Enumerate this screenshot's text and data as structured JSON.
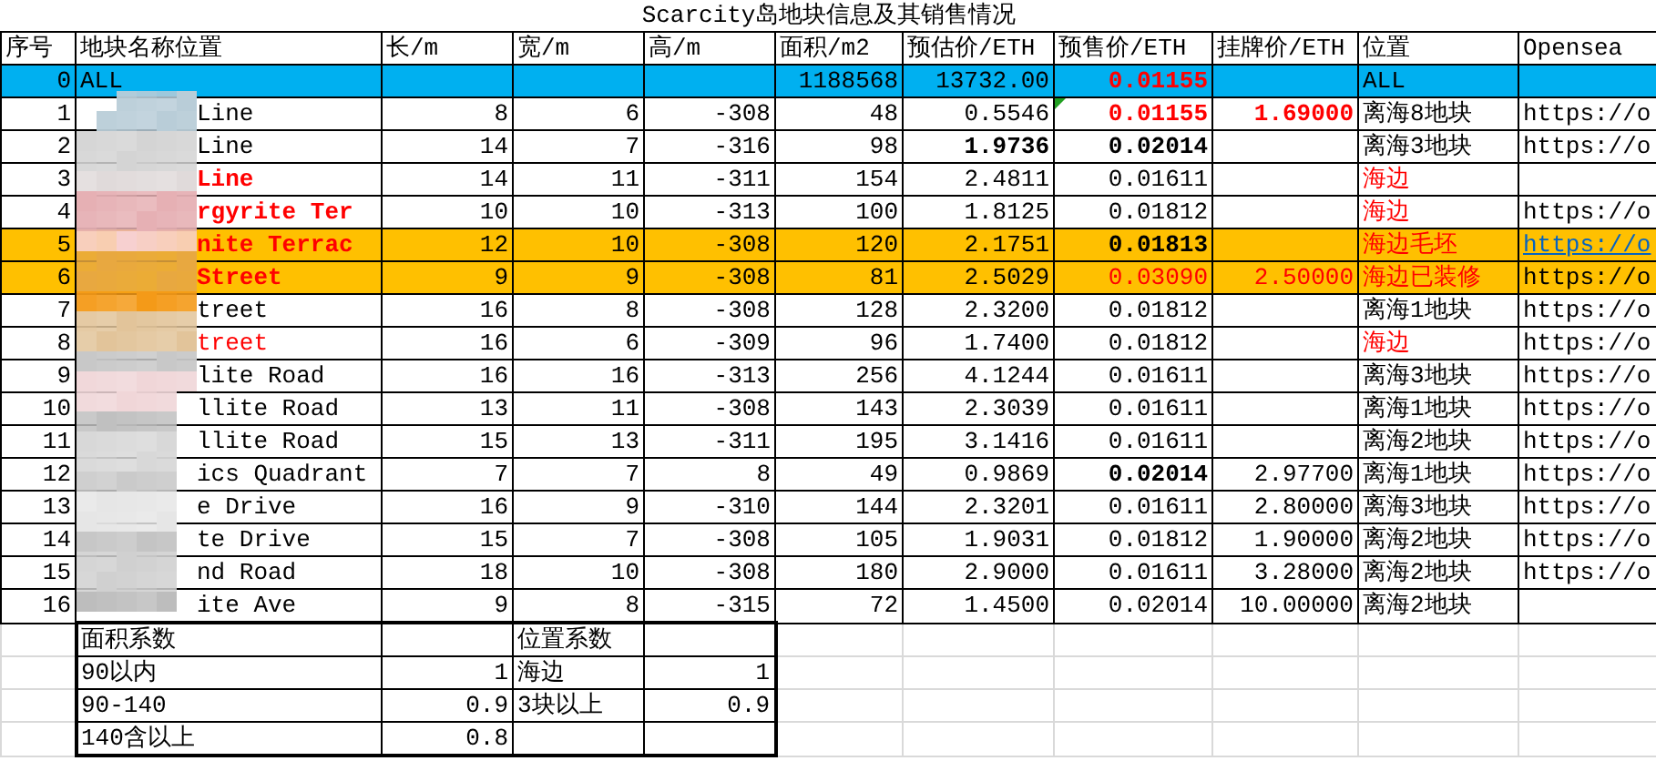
{
  "title": "Scarcity岛地块信息及其销售情况",
  "columns": [
    "序号",
    "地块名称位置",
    "长/m",
    "宽/m",
    "高/m",
    "面积/m2",
    "预估价/ETH",
    "预售价/ETH",
    "挂牌价/ETH",
    "位置",
    "Opensea"
  ],
  "rows": [
    {
      "cells": [
        "0",
        "ALL",
        null,
        null,
        null,
        "1188568",
        "13732.00",
        {
          "text": "0.01155",
          "red": true,
          "bold": true
        },
        null,
        "ALL",
        null
      ],
      "color": "#00b0f0"
    },
    {
      "cells": [
        "1",
        "Line",
        "8",
        "6",
        "-308",
        "48",
        "0.5546",
        {
          "text": "0.01155",
          "red": true,
          "bold": true,
          "note": true
        },
        {
          "text": "1.69000",
          "red": true,
          "bold": true
        },
        "离海8地块",
        "https://o"
      ]
    },
    {
      "cells": [
        "2",
        "Line",
        "14",
        "7",
        "-316",
        "98",
        {
          "text": "1.9736",
          "red": false,
          "bold": true
        },
        {
          "text": "0.02014",
          "red": false,
          "bold": true
        },
        null,
        "离海3地块",
        "https://o"
      ]
    },
    {
      "cells": [
        "3",
        {
          "text": "Line",
          "red": true,
          "bold": true
        },
        "14",
        "11",
        "-311",
        "154",
        "2.4811",
        "0.01611",
        null,
        {
          "text": "海边",
          "red": true,
          "bold": false
        },
        null
      ]
    },
    {
      "cells": [
        "4",
        {
          "text": "rgyrite Ter",
          "red": true,
          "bold": true
        },
        "10",
        "10",
        "-313",
        "100",
        "1.8125",
        "0.01812",
        null,
        {
          "text": "海边",
          "red": true,
          "bold": false
        },
        "https://o"
      ]
    },
    {
      "cells": [
        "5",
        {
          "text": "nite Terrac",
          "red": true,
          "bold": true
        },
        "12",
        "10",
        "-308",
        "120",
        "2.1751",
        {
          "text": "0.01813",
          "red": false,
          "bold": true
        },
        null,
        {
          "text": "海边毛坯",
          "red": true,
          "bold": false
        },
        {
          "text": "https://o",
          "link": true
        }
      ],
      "color": "#ffc000"
    },
    {
      "cells": [
        "6",
        {
          "text": "Street",
          "red": true,
          "bold": true
        },
        "9",
        "9",
        "-308",
        "81",
        "2.5029",
        {
          "text": "0.03090",
          "red": true,
          "bold": false
        },
        {
          "text": "2.50000",
          "red": true,
          "bold": false
        },
        {
          "text": "海边已装修",
          "red": true,
          "bold": false
        },
        "https://o"
      ],
      "color": "#ffc000"
    },
    {
      "cells": [
        "7",
        "treet",
        "16",
        "8",
        "-308",
        "128",
        "2.3200",
        "0.01812",
        null,
        "离海1地块",
        "https://o"
      ]
    },
    {
      "cells": [
        "8",
        {
          "text": "treet",
          "red": true,
          "bold": false
        },
        "16",
        "6",
        "-309",
        "96",
        "1.7400",
        "0.01812",
        null,
        {
          "text": "海边",
          "red": true,
          "bold": false
        },
        "https://o"
      ]
    },
    {
      "cells": [
        "9",
        "lite Road",
        "16",
        "16",
        "-313",
        "256",
        "4.1244",
        "0.01611",
        null,
        "离海3地块",
        "https://o"
      ]
    },
    {
      "cells": [
        "10",
        "llite Road",
        "13",
        "11",
        "-308",
        "143",
        "2.3039",
        "0.01611",
        null,
        "离海1地块",
        "https://o"
      ]
    },
    {
      "cells": [
        "11",
        "llite Road",
        "15",
        "13",
        "-311",
        "195",
        "3.1416",
        "0.01611",
        null,
        "离海2地块",
        "https://o"
      ]
    },
    {
      "cells": [
        "12",
        "ics Quadrant",
        "7",
        "7",
        "8",
        "49",
        "0.9869",
        {
          "text": "0.02014",
          "red": false,
          "bold": true
        },
        "2.97700",
        "离海1地块",
        "https://o"
      ]
    },
    {
      "cells": [
        "13",
        "e Drive",
        "16",
        "9",
        "-310",
        "144",
        "2.3201",
        "0.01611",
        "2.80000",
        "离海3地块",
        "https://o"
      ]
    },
    {
      "cells": [
        "14",
        "te Drive",
        "15",
        "7",
        "-308",
        "105",
        "1.9031",
        "0.01812",
        "1.90000",
        "离海2地块",
        "https://o"
      ]
    },
    {
      "cells": [
        "15",
        "nd Road",
        "18",
        "10",
        "-308",
        "180",
        "2.9000",
        "0.01611",
        "3.28000",
        "离海2地块",
        "https://o"
      ]
    },
    {
      "cells": [
        "16",
        "ite Ave",
        "9",
        "8",
        "-315",
        "72",
        "1.4500",
        "0.02014",
        "10.00000",
        "离海2地块",
        null
      ]
    }
  ],
  "coefficients": {
    "area_title": "面积系数",
    "location_title": "位置系数",
    "rows": [
      {
        "area_label": "90以内",
        "area_value": "1",
        "location_label": "海边",
        "location_value": "1"
      },
      {
        "area_label": "90-140",
        "area_value": "0.9",
        "location_label": "3块以上",
        "location_value": "0.9"
      },
      {
        "area_label": "140含以上",
        "area_value": "0.8"
      }
    ]
  }
}
